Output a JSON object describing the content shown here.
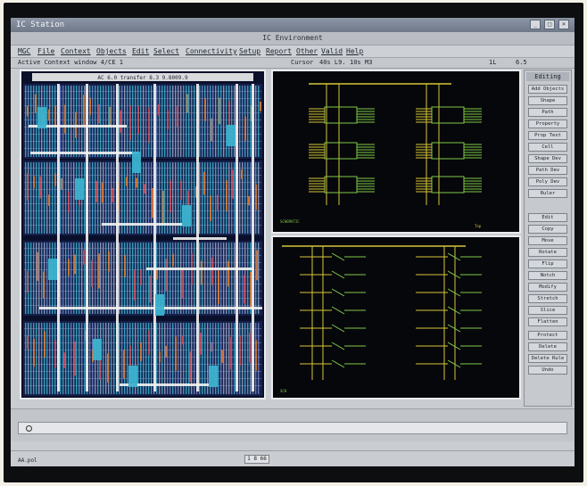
{
  "os_window": {
    "title": "IC Station",
    "buttons": [
      "minimize",
      "maximize",
      "close"
    ]
  },
  "app": {
    "title": "IC Environment"
  },
  "menu": [
    "MGC",
    "File",
    "Context",
    "Objects",
    "Edit",
    "Select",
    "Connectivity",
    "Setup",
    "Report",
    "Other",
    "Valid",
    "Help"
  ],
  "status": {
    "context": "Active Context  window 4/CE 1",
    "cursor_label": "Cursor",
    "x_value": "40s L9.",
    "y_value": "10s M3",
    "scale": "1L",
    "grid": "6.5"
  },
  "layout_pane": {
    "header": "AC 6.0   transfer 8.3 9.8009.9"
  },
  "schematic_top": {
    "corner_label": "SCHEMATIC",
    "footer": "Top"
  },
  "schematic_bottom": {
    "corner_label": "SCH"
  },
  "palette": {
    "title": "Editing",
    "buttons_a": [
      "Add Objects",
      "Shape",
      "Path",
      "Property",
      "Prop Text",
      "Cell",
      "Shape Dev",
      "Path Dev",
      "Poly Dev",
      "Ruler"
    ],
    "buttons_b": [
      "Edit",
      "Copy",
      "Move",
      "Rotate",
      "Flip",
      "Notch",
      "Modify",
      "Stretch",
      "Slice",
      "Flatten"
    ],
    "buttons_c": [
      "Protect",
      "Delete",
      "Delete Rule",
      "Undo"
    ]
  },
  "bottom": {
    "mode": "AA.pol",
    "page": "1  8  66"
  },
  "colors": {
    "layout_bg": "#0a0f2a",
    "wire_cyan": "#3bb2cf",
    "wire_white": "#f2f2f0",
    "orange": "#d8782e",
    "schematic_yellow": "#d6c63a",
    "schematic_green": "#7fc948"
  }
}
